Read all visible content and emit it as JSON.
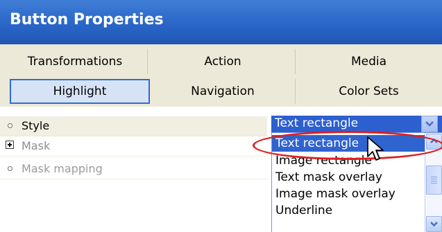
{
  "window": {
    "title": "Button Properties"
  },
  "tabs": {
    "row1": [
      "Transformations",
      "Action",
      "Media"
    ],
    "row2": [
      "Highlight",
      "Navigation",
      "Color Sets"
    ],
    "selected": "Highlight"
  },
  "properties": [
    {
      "label": "Style",
      "marker": "bullet",
      "enabled": true
    },
    {
      "label": "Mask",
      "marker": "expand-plus-icon",
      "enabled": false
    },
    {
      "label": "Mask mapping",
      "marker": "bullet",
      "enabled": false
    }
  ],
  "style_combo": {
    "value": "Text rectangle",
    "options": [
      "Text rectangle",
      "Image rectangle",
      "Text mask overlay",
      "Image mask overlay",
      "Underline"
    ],
    "highlighted_option": "Text rectangle"
  },
  "annotation": {
    "color": "#e11e1e"
  },
  "colors": {
    "title_bar": "#2a66c7",
    "selection": "#2f63cf",
    "panel": "#ece9d8"
  }
}
